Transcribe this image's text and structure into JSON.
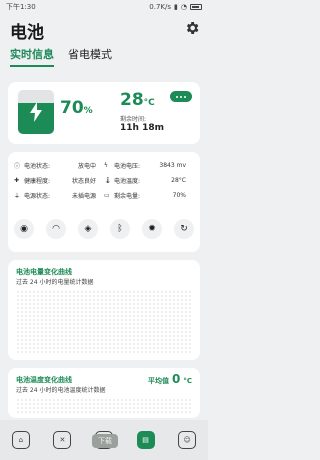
{
  "statusbar": {
    "time": "下午1:30",
    "speed": "0.7K/s"
  },
  "header": {
    "title": "电池"
  },
  "tabs": [
    {
      "label": "实时信息",
      "active": true
    },
    {
      "label": "省电模式",
      "active": false
    }
  ],
  "overview": {
    "percent": "70",
    "percent_unit": "%",
    "level_fraction": 0.7,
    "temperature": "28",
    "temperature_unit": "°C",
    "remaining_label": "剩余时间:",
    "remaining_value": "11h 18m"
  },
  "info": [
    {
      "icon": "info-icon",
      "label": "电池状态:",
      "value": "放电中"
    },
    {
      "icon": "bolt-icon",
      "label": "电池电压:",
      "value": "3843 mv"
    },
    {
      "icon": "health-icon",
      "label": "健康程度:",
      "value": "状态良好"
    },
    {
      "icon": "thermometer-icon",
      "label": "电池温度:",
      "value": "28°C"
    },
    {
      "icon": "plug-icon",
      "label": "电源状态:",
      "value": "未插电源"
    },
    {
      "icon": "battery-icon",
      "label": "剩余电量:",
      "value": "70%"
    }
  ],
  "quick_toggles": [
    "eye-icon",
    "wifi-icon",
    "hotspot-icon",
    "bluetooth-icon",
    "brightness-icon",
    "rotate-icon"
  ],
  "chart_power": {
    "title": "电池电量变化曲线",
    "subtitle": "过去 24 小时的电量统计数据"
  },
  "chart_temp": {
    "title": "电池温度变化曲线",
    "subtitle": "过去 24 小时的电池温度统计数据",
    "avg_label": "平均值",
    "avg_value": "0",
    "avg_unit": "°C"
  },
  "bottom_nav": {
    "toast": "下载",
    "items": [
      "home-icon",
      "tools-icon",
      "cleaner-icon",
      "battery-nav-icon",
      "profile-icon"
    ]
  },
  "colors": {
    "accent": "#1d8b55"
  }
}
